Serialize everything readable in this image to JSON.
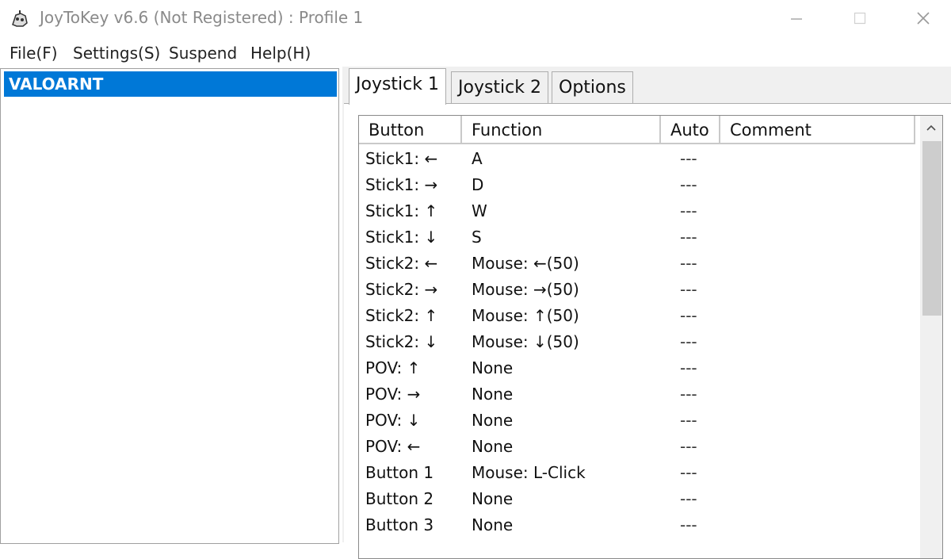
{
  "window": {
    "title": "JoyToKey v6.6 (Not Registered) : Profile 1"
  },
  "menu": {
    "items": [
      "File(F)",
      "Settings(S)",
      "Suspend",
      "Help(H)"
    ]
  },
  "profiles": {
    "items": [
      "VALOARNT"
    ],
    "selected": "VALOARNT"
  },
  "tabs": {
    "items": [
      "Joystick 1",
      "Joystick 2",
      "Options"
    ],
    "active": "Joystick 1"
  },
  "table": {
    "columns": [
      "Button",
      "Function",
      "Auto",
      "Comment"
    ],
    "rows": [
      {
        "button": "Stick1: ←",
        "function": "A",
        "auto": "---",
        "comment": ""
      },
      {
        "button": "Stick1: →",
        "function": "D",
        "auto": "---",
        "comment": ""
      },
      {
        "button": "Stick1: ↑",
        "function": "W",
        "auto": "---",
        "comment": ""
      },
      {
        "button": "Stick1: ↓",
        "function": "S",
        "auto": "---",
        "comment": ""
      },
      {
        "button": "Stick2: ←",
        "function": "Mouse: ←(50)",
        "auto": "---",
        "comment": ""
      },
      {
        "button": "Stick2: →",
        "function": "Mouse: →(50)",
        "auto": "---",
        "comment": ""
      },
      {
        "button": "Stick2: ↑",
        "function": "Mouse: ↑(50)",
        "auto": "---",
        "comment": ""
      },
      {
        "button": "Stick2: ↓",
        "function": "Mouse: ↓(50)",
        "auto": "---",
        "comment": ""
      },
      {
        "button": "POV: ↑",
        "function": "None",
        "auto": "---",
        "comment": ""
      },
      {
        "button": "POV: →",
        "function": "None",
        "auto": "---",
        "comment": ""
      },
      {
        "button": "POV: ↓",
        "function": "None",
        "auto": "---",
        "comment": ""
      },
      {
        "button": "POV: ←",
        "function": "None",
        "auto": "---",
        "comment": ""
      },
      {
        "button": "Button 1",
        "function": "Mouse: L-Click",
        "auto": "---",
        "comment": ""
      },
      {
        "button": "Button 2",
        "function": "None",
        "auto": "---",
        "comment": ""
      },
      {
        "button": "Button 3",
        "function": "None",
        "auto": "---",
        "comment": ""
      }
    ]
  },
  "icons": {
    "app": "joytokey-app-icon",
    "minimize": "minimize-icon",
    "maximize": "maximize-icon",
    "close": "close-icon",
    "scroll_up": "chevron-up-icon"
  },
  "colors": {
    "selection": "#0078d7",
    "window_bg": "#f0f0f0",
    "title_text": "#8a8a8a"
  }
}
